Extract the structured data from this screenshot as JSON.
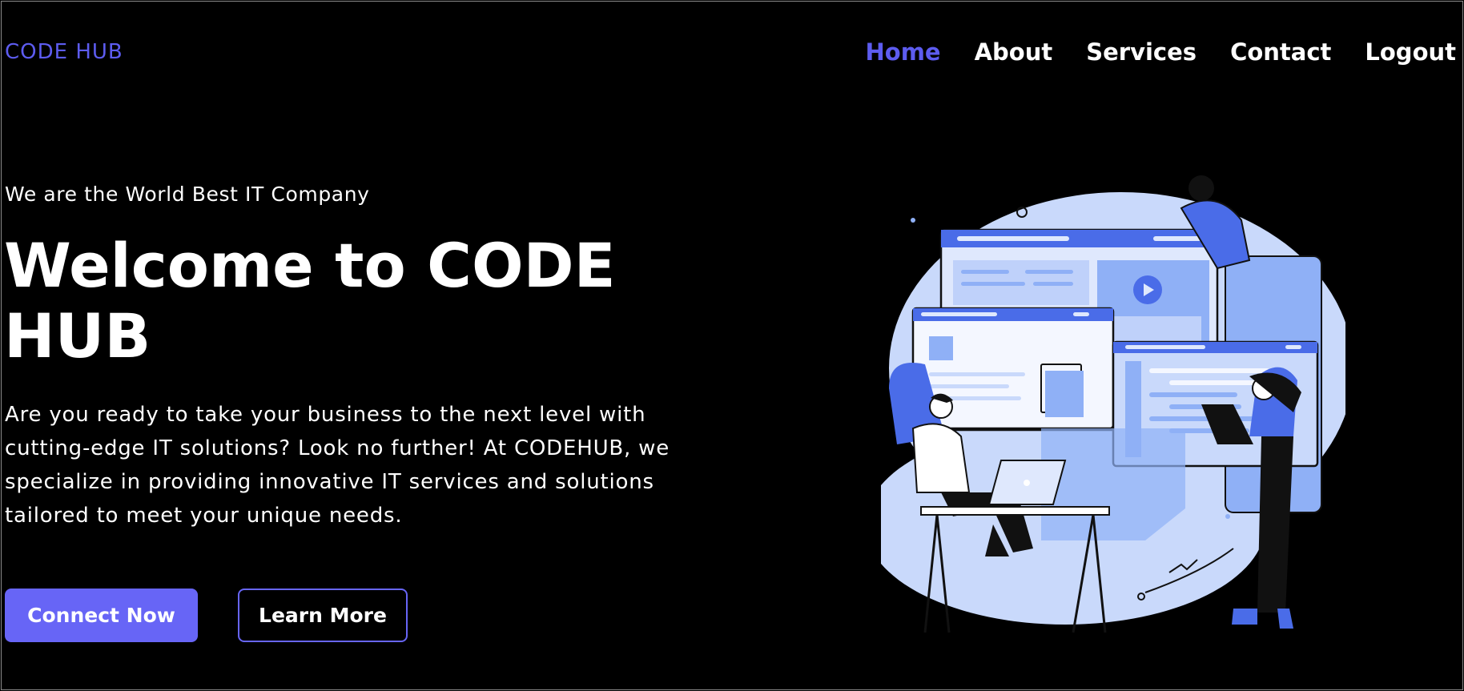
{
  "header": {
    "logo": "CODE HUB",
    "nav": [
      {
        "label": "Home",
        "active": true
      },
      {
        "label": "About",
        "active": false
      },
      {
        "label": "Services",
        "active": false
      },
      {
        "label": "Contact",
        "active": false
      },
      {
        "label": "Logout",
        "active": false
      }
    ]
  },
  "hero": {
    "tagline": "We are the World Best IT Company",
    "title": "Welcome to CODE HUB",
    "description": "Are you ready to take your business to the next level with cutting-edge IT solutions? Look no further! At CODEHUB, we specialize in providing innovative IT services and solutions tailored to meet your unique needs.",
    "primary_button": "Connect Now",
    "secondary_button": "Learn More",
    "illustration_icon": "team-working-illustration"
  },
  "colors": {
    "accent": "#5d5cf0",
    "button": "#6765f6",
    "background": "#000000",
    "illustration_light": "#c9d9fb",
    "illustration_mid": "#8fb0f6",
    "illustration_dark": "#4a6ce8"
  }
}
